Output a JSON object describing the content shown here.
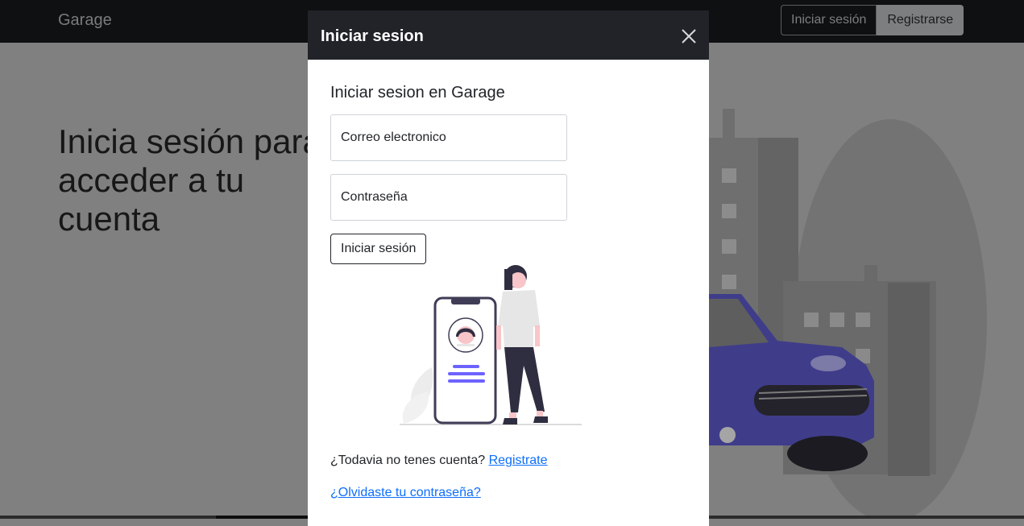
{
  "navbar": {
    "brand": "Garage",
    "login_label": "Iniciar sesión",
    "register_label": "Registrarse"
  },
  "hero": {
    "headline": "Inicia sesión para\nacceder a tu\ncuenta"
  },
  "modal": {
    "title": "Iniciar sesion",
    "form_heading": "Iniciar sesion en Garage",
    "email_placeholder": "Correo electronico",
    "password_placeholder": "Contraseña",
    "submit_label": "Iniciar sesión",
    "signup_prompt": "¿Todavia no tenes cuenta?",
    "signup_link": "Registrate",
    "forgot_link": "¿Olvidaste tu contraseña?"
  },
  "colors": {
    "accent": "#6c63ff",
    "car": "#3f3d8a",
    "link": "#0d6efd",
    "header": "#212328"
  },
  "icons": {
    "close": "close-icon"
  }
}
